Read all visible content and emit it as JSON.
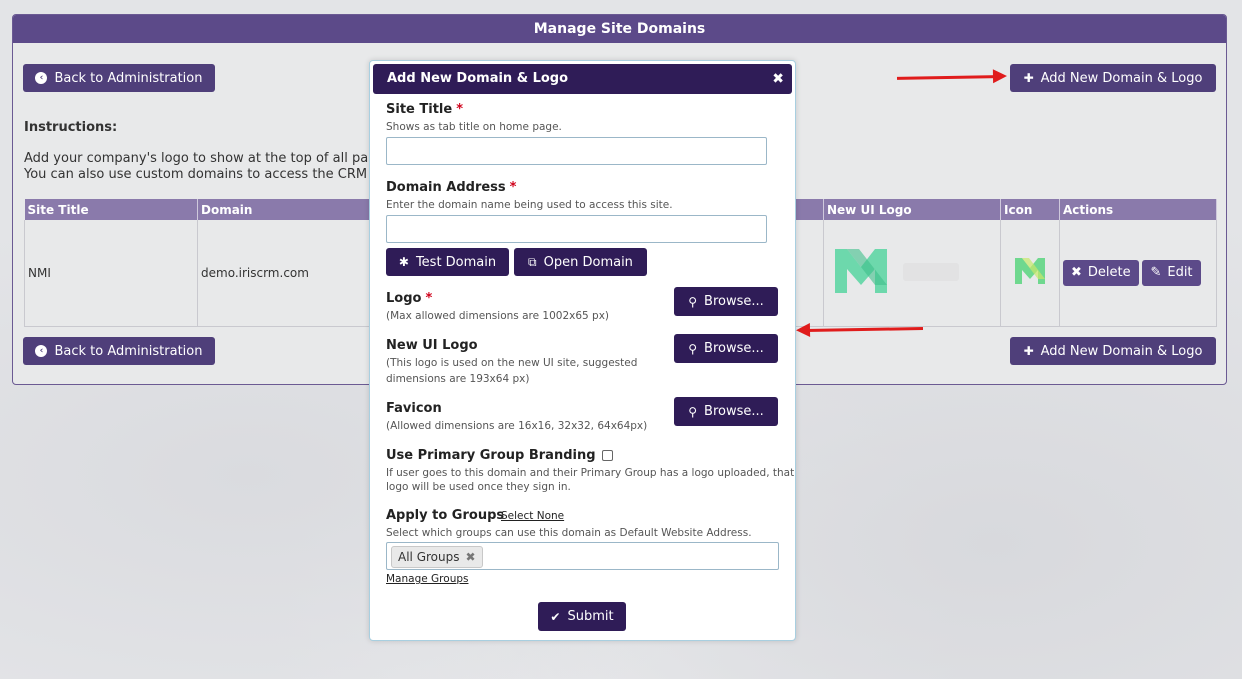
{
  "panel": {
    "title": "Manage Site Domains",
    "back_label": "Back to Administration",
    "add_label": "Add New Domain & Logo",
    "instructions_title": "Instructions:",
    "instructions_line1": "Add your company's logo to show at the top of all pa",
    "instructions_line2": "You can also use custom domains to access the CRM"
  },
  "table": {
    "headers": [
      "Site Title",
      "Domain",
      "New UI Logo",
      "Icon",
      "Actions"
    ],
    "rows": [
      {
        "site_title": "NMI",
        "domain": "demo.iriscrm.com",
        "delete_label": "Delete",
        "edit_label": "Edit"
      }
    ]
  },
  "modal": {
    "title": "Add New Domain & Logo",
    "close_glyph": "✖",
    "site_title_label": "Site Title",
    "site_title_hint": "Shows as tab title on home page.",
    "site_title_value": "",
    "domain_label": "Domain Address",
    "domain_hint": "Enter the domain name being used to access this site.",
    "domain_value": "",
    "test_domain_label": "Test Domain",
    "open_domain_label": "Open Domain",
    "logo_label": "Logo",
    "logo_hint": "(Max allowed dimensions are 1002x65 px)",
    "browse_label": "Browse...",
    "new_ui_logo_label": "New UI Logo",
    "new_ui_logo_hint1": "(This logo is used on the new UI site, suggested",
    "new_ui_logo_hint2": "dimensions are 193x64 px)",
    "favicon_label": "Favicon",
    "favicon_hint": "(Allowed dimensions are 16x16, 32x32, 64x64px)",
    "primary_branding_label": "Use Primary Group Branding",
    "primary_branding_hint1": "If user goes to this domain and their Primary Group has a logo uploaded, that",
    "primary_branding_hint2": "logo will be used once they sign in.",
    "apply_groups_label": "Apply to Groups",
    "select_none_label": "Select None",
    "apply_groups_hint": "Select which groups can use this domain as Default Website Address.",
    "selected_group": "All Groups",
    "manage_groups_label": "Manage Groups",
    "submit_label": "Submit",
    "required_mark": "*"
  },
  "colors": {
    "header_purple": "#5c4a89",
    "modal_header": "#2f1c57",
    "table_header": "#8a7aab",
    "arrow_red": "#e01c1c",
    "logo_green": "#5fd6a5"
  },
  "icons": {
    "back": "circle-chevron-left-icon",
    "add": "plus-icon",
    "test_domain": "gear-icon",
    "open_domain": "external-window-icon",
    "browse": "search-icon",
    "delete": "x-icon",
    "edit": "pencil-icon",
    "submit": "check-icon"
  }
}
